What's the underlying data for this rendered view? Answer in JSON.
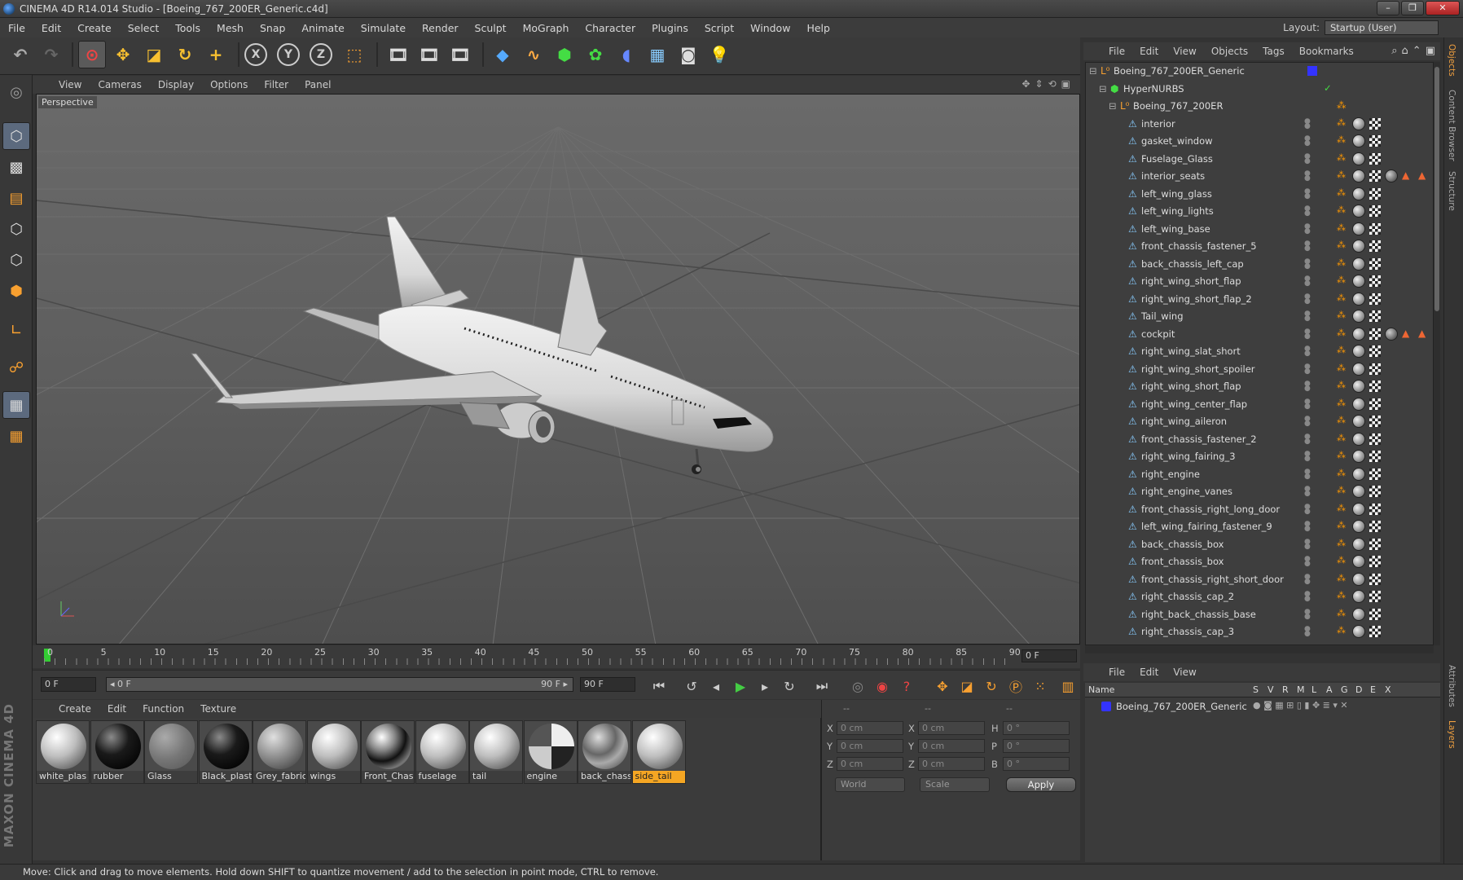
{
  "window": {
    "title": "CINEMA 4D R14.014 Studio - [Boeing_767_200ER_Generic.c4d]",
    "buttons": [
      "–",
      "❐",
      "✕"
    ]
  },
  "menubar": {
    "items": [
      "File",
      "Edit",
      "Create",
      "Select",
      "Tools",
      "Mesh",
      "Snap",
      "Animate",
      "Simulate",
      "Render",
      "Sculpt",
      "MoGraph",
      "Character",
      "Plugins",
      "Script",
      "Window",
      "Help"
    ],
    "layout_label": "Layout:",
    "layout_value": "Startup (User)"
  },
  "toolbar": {
    "axis_x": "X",
    "axis_y": "Y",
    "axis_z": "Z"
  },
  "viewport": {
    "menu": [
      "View",
      "Cameras",
      "Display",
      "Options",
      "Filter",
      "Panel"
    ],
    "label": "Perspective"
  },
  "timeline": {
    "ticks": [
      "0",
      "5",
      "10",
      "15",
      "20",
      "25",
      "30",
      "35",
      "40",
      "45",
      "50",
      "55",
      "60",
      "65",
      "70",
      "75",
      "80",
      "85",
      "90"
    ],
    "current_frame": "0 F"
  },
  "transport": {
    "start_field": "0 F",
    "range_start": "◂ 0 F",
    "range_end": "90 F ▸",
    "end_field": "90 F"
  },
  "materials": {
    "menu": [
      "Create",
      "Edit",
      "Function",
      "Texture"
    ],
    "items": [
      {
        "name": "white_plas",
        "style": "white"
      },
      {
        "name": "rubber",
        "style": "black"
      },
      {
        "name": "Glass",
        "style": "glass"
      },
      {
        "name": "Black_plast",
        "style": "black"
      },
      {
        "name": "Grey_fabric",
        "style": "grey"
      },
      {
        "name": "wings",
        "style": "white"
      },
      {
        "name": "Front_Chas",
        "style": "texture"
      },
      {
        "name": "fuselage",
        "style": "white"
      },
      {
        "name": "tail",
        "style": "white"
      },
      {
        "name": "engine",
        "style": "engine"
      },
      {
        "name": "back_chass",
        "style": "texture2"
      },
      {
        "name": "side_tail",
        "style": "white"
      }
    ],
    "selected": "side_tail"
  },
  "coordinates": {
    "headers": [
      "--",
      "--",
      "--"
    ],
    "rows": [
      {
        "a": "X",
        "av": "0 cm",
        "b": "X",
        "bv": "0 cm",
        "c": "H",
        "cv": "0 °"
      },
      {
        "a": "Y",
        "av": "0 cm",
        "b": "Y",
        "bv": "0 cm",
        "c": "P",
        "cv": "0 °"
      },
      {
        "a": "Z",
        "av": "0 cm",
        "b": "Z",
        "bv": "0 cm",
        "c": "B",
        "cv": "0 °"
      }
    ],
    "space": "World",
    "mode": "Scale",
    "apply": "Apply"
  },
  "objects": {
    "menu": [
      "File",
      "Edit",
      "View",
      "Objects",
      "Tags",
      "Bookmarks"
    ],
    "root": "Boeing_767_200ER_Generic",
    "hypernurbs": "HyperNURBS",
    "group": "Boeing_767_200ER",
    "children": [
      {
        "name": "interior"
      },
      {
        "name": "gasket_window"
      },
      {
        "name": "Fuselage_Glass"
      },
      {
        "name": "interior_seats",
        "warn": true
      },
      {
        "name": "left_wing_glass"
      },
      {
        "name": "left_wing_lights"
      },
      {
        "name": "left_wing_base"
      },
      {
        "name": "front_chassis_fastener_5"
      },
      {
        "name": "back_chassis_left_cap"
      },
      {
        "name": "right_wing_short_flap"
      },
      {
        "name": "right_wing_short_flap_2"
      },
      {
        "name": "Tail_wing"
      },
      {
        "name": "cockpit",
        "warn": true
      },
      {
        "name": "right_wing_slat_short"
      },
      {
        "name": "right_wing_short_spoiler"
      },
      {
        "name": "right_wing_short_flap"
      },
      {
        "name": "right_wing_center_flap"
      },
      {
        "name": "right_wing_aileron"
      },
      {
        "name": "front_chassis_fastener_2"
      },
      {
        "name": "right_wing_fairing_3"
      },
      {
        "name": "right_engine"
      },
      {
        "name": "right_engine_vanes"
      },
      {
        "name": "front_chassis_right_long_door"
      },
      {
        "name": "left_wing_fairing_fastener_9"
      },
      {
        "name": "back_chassis_box"
      },
      {
        "name": "front_chassis_box"
      },
      {
        "name": "front_chassis_right_short_door"
      },
      {
        "name": "right_chassis_cap_2"
      },
      {
        "name": "right_back_chassis_base"
      },
      {
        "name": "right_chassis_cap_3"
      }
    ]
  },
  "layers": {
    "menu": [
      "File",
      "Edit",
      "View"
    ],
    "columns": [
      "Name",
      "S",
      "V",
      "R",
      "M",
      "L",
      "A",
      "G",
      "D",
      "E",
      "X"
    ],
    "row_name": "Boeing_767_200ER_Generic"
  },
  "sidetabs": [
    "Objects",
    "Content Browser",
    "Structure",
    "Attributes",
    "Layers"
  ],
  "status": "Move: Click and drag to move elements. Hold down SHIFT to quantize movement / add to the selection in point mode, CTRL to remove.",
  "brand": "MAXON CINEMA 4D",
  "colors": {
    "accent": "#f5a623",
    "layer_color": "#3333ff",
    "playhead": "#33cc33"
  }
}
